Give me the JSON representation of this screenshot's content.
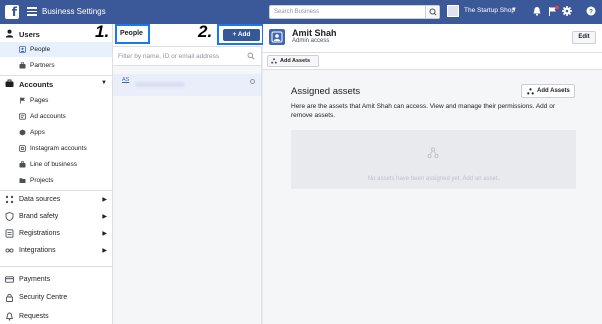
{
  "topbar": {
    "app_title": "Business Settings",
    "search_placeholder": "Search Business",
    "business_name": "The Startup Shop",
    "accent_color": "#3b5998"
  },
  "sidebar": {
    "users": {
      "label": "Users",
      "items": [
        {
          "label": "People",
          "icon": "person-icon",
          "active": true
        },
        {
          "label": "Partners",
          "icon": "briefcase-icon",
          "active": false
        }
      ]
    },
    "accounts": {
      "label": "Accounts",
      "items": [
        {
          "label": "Pages",
          "icon": "flag-icon"
        },
        {
          "label": "Ad accounts",
          "icon": "ad-icon"
        },
        {
          "label": "Apps",
          "icon": "cube-icon"
        },
        {
          "label": "Instagram accounts",
          "icon": "instagram-icon"
        },
        {
          "label": "Line of business",
          "icon": "suitcase-icon"
        },
        {
          "label": "Projects",
          "icon": "folder-icon"
        }
      ]
    },
    "groups": [
      {
        "label": "Data sources",
        "icon": "data-icon"
      },
      {
        "label": "Brand safety",
        "icon": "shield-icon"
      },
      {
        "label": "Registrations",
        "icon": "registration-icon"
      },
      {
        "label": "Integrations",
        "icon": "integration-icon"
      }
    ],
    "bottom": [
      {
        "label": "Payments",
        "icon": "card-icon"
      },
      {
        "label": "Security Centre",
        "icon": "lock-icon"
      },
      {
        "label": "Requests",
        "icon": "bell-icon"
      }
    ]
  },
  "people_panel": {
    "tab_label": "People",
    "add_label": "+ Add",
    "filter_placeholder": "Filter by name, ID or email address",
    "steps": {
      "one": "1.",
      "two": "2."
    },
    "person": {
      "initials": "AS"
    }
  },
  "detail": {
    "user_name": "Amit Shah",
    "user_role": "Admin access",
    "edit_label": "Edit",
    "subbar_button": "Add Assets",
    "assigned_title": "Assigned assets",
    "assigned_desc": "Here are the assets that Amit Shah can access. View and manage their permissions. Add or remove assets.",
    "add_assets_label": "Add Assets",
    "empty_text": "No assets have been assigned yet. Add an asset."
  }
}
